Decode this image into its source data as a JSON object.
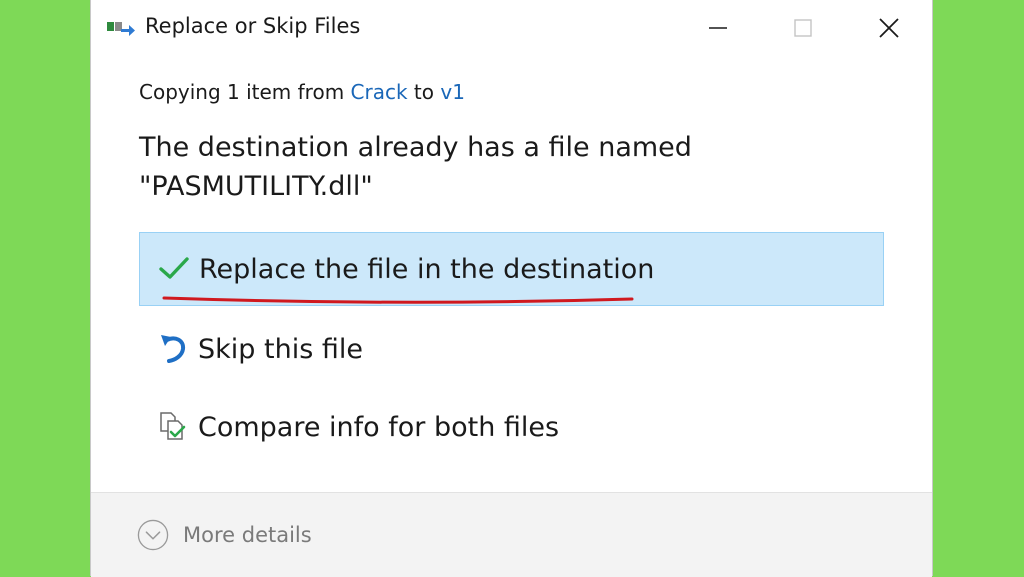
{
  "window": {
    "title": "Replace or Skip Files"
  },
  "copying": {
    "prefix": "Copying 1 item from ",
    "source": "Crack",
    "middle": " to ",
    "destination": "v1"
  },
  "message": {
    "line1": "The destination already has a file named",
    "line2": "\"PASMUTILITY.dll\""
  },
  "options": [
    {
      "label": "Replace the file in the destination",
      "icon": "checkmark-icon",
      "selected": true
    },
    {
      "label": "Skip this file",
      "icon": "skip-arrow-icon",
      "selected": false
    },
    {
      "label": "Compare info for both files",
      "icon": "compare-files-icon",
      "selected": false
    }
  ],
  "footer": {
    "more_details": "More details"
  },
  "colors": {
    "background": "#7ed957",
    "link": "#1a67b8",
    "selected_bg": "#cce8fa",
    "selected_border": "#99d1f5",
    "check_green": "#2aa84a",
    "annotation_red": "#d0191f"
  }
}
